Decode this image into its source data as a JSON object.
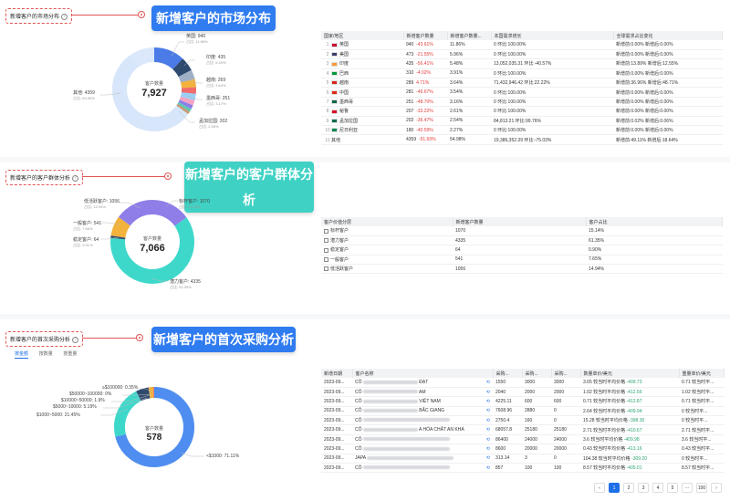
{
  "s1": {
    "tag": "新增客户的市场分布",
    "banner": "新增客户的市场分布",
    "center_label": "客户数量",
    "center_value": "7,927",
    "labels": [
      {
        "name": "英国: 940",
        "pct": "占比: 11.86%"
      },
      {
        "name": "印度: 435",
        "pct": "占比: 5.49%"
      },
      {
        "name": "越南: 269",
        "pct": "占比: 3.64%"
      },
      {
        "name": "墨西哥: 251",
        "pct": "占比: 3.17%"
      },
      {
        "name": "孟加拉国: 202",
        "pct": "占比: 2.55%"
      },
      {
        "name": "其他: 4359",
        "pct": "占比: 54.99%"
      }
    ],
    "headers": [
      "国家/地区",
      "新增客户数量",
      "新增客户数量...",
      "本国需求增长",
      "全球需求占比变化"
    ],
    "rows": [
      {
        "rank": "1",
        "country": "英国",
        "count": "940",
        "chg": "-43.61%",
        "pct": "11.86%",
        "growth": "0  环比:100.00%",
        "share": "新增前:0.00%   新增后:0.00%"
      },
      {
        "rank": "2",
        "country": "美国",
        "count": "473",
        "chg": "-21.55%",
        "pct": "5.96%",
        "growth": "0  环比:100.00%",
        "share": "新增前:0.00%   新增后:0.00%"
      },
      {
        "rank": "3",
        "country": "印度",
        "count": "435",
        "chg": "-56.41%",
        "pct": "5.48%",
        "growth": "13,052,035.31  环比:-40.57%",
        "share": "新增前:13.89%   新增后:12.55%"
      },
      {
        "rank": "4",
        "country": "巴西",
        "count": "310",
        "chg": "-4.02%",
        "pct": "3.91%",
        "growth": "0  环比:100.00%",
        "share": "新增前:0.00%   新增后:0.00%"
      },
      {
        "rank": "5",
        "country": "越南",
        "count": "289",
        "chg": "4.71%",
        "pct": "3.64%",
        "growth": "71,432,946.42  环比:22.22%",
        "share": "新增前:36.96%   新增后:48.71%"
      },
      {
        "rank": "6",
        "country": "中国",
        "count": "281",
        "chg": "-46.67%",
        "pct": "3.54%",
        "growth": "0  环比:100.00%",
        "share": "新增前:0.00%   新增后:0.00%"
      },
      {
        "rank": "7",
        "country": "墨西哥",
        "count": "251",
        "chg": "-48.70%",
        "pct": "3.16%",
        "growth": "0  环比:100.00%",
        "share": "新增前:0.00%   新增后:0.00%"
      },
      {
        "rank": "8",
        "country": "秘鲁",
        "count": "207",
        "chg": "-33.22%",
        "pct": "2.61%",
        "growth": "0  环比:100.00%",
        "share": "新增前:0.00%   新增后:0.00%"
      },
      {
        "rank": "9",
        "country": "孟加拉国",
        "count": "202",
        "chg": "-36.47%",
        "pct": "2.54%",
        "growth": "84,813.21  环比:99.76%",
        "share": "新增前:0.02%   新增后:0.06%"
      },
      {
        "rank": "10",
        "country": "尼日利亚",
        "count": "180",
        "chg": "-40.59%",
        "pct": "2.27%",
        "growth": "0  环比:100.00%",
        "share": "新增前:0.00%   新增后:0.00%"
      },
      {
        "rank": "11",
        "country": "其他",
        "count": "4359",
        "chg": "-51.69%",
        "pct": "54.98%",
        "growth": "19,386,352.39  环比:-75.03%",
        "share": "新增前:49.11%   新增后:18.64%"
      }
    ]
  },
  "s2": {
    "tag": "新增客户的客户群体分析",
    "banner": "新增客户的客户群体分析",
    "center_label": "客户数量",
    "center_value": "7,066",
    "labels": [
      {
        "name": "低活跃客户: 1056",
        "pct": "占比: 14.94%"
      },
      {
        "name": "一般客户: 541",
        "pct": "占比: 7.66%"
      },
      {
        "name": "稳定客户: 64",
        "pct": "占比: 0.91%"
      },
      {
        "name": "标杆客户: 1070",
        "pct": "占比: 15.14%"
      },
      {
        "name": "潜力客户: 4335",
        "pct": "占比: 61.35%"
      }
    ],
    "headers": [
      "客户价值分层",
      "新增客户数量",
      "客户占比"
    ],
    "rows": [
      {
        "name": "标杆客户",
        "count": "1070",
        "pct": "15.14%"
      },
      {
        "name": "潜力客户",
        "count": "4335",
        "pct": "61.35%"
      },
      {
        "name": "稳定客户",
        "count": "64",
        "pct": "0.90%"
      },
      {
        "name": "一般客户",
        "count": "541",
        "pct": "7.65%"
      },
      {
        "name": "低活跃客户",
        "count": "1056",
        "pct": "14.94%"
      }
    ]
  },
  "s3": {
    "tag": "新增客户的首次采购分析",
    "banner": "新增客户的首次采购分析",
    "tabs": [
      "按金额",
      "按数量",
      "按重量"
    ],
    "center_label": "客户数量",
    "center_value": "578",
    "labels": [
      "≥$100000: 0.35%",
      "$50000~100000: 0%",
      "$10000~50000: 1.9%",
      "$5000~10000: 5.19%",
      "$1000~5000: 21.45%",
      "<$1000: 71.11%"
    ],
    "headers": [
      "新增日期",
      "客户名称",
      "采购...",
      "采购...",
      "采购...",
      "数量单价/美元",
      "重量单价/美元"
    ],
    "rows": [
      {
        "date": "2023-09...",
        "name": "CÔ",
        "tail": "ĐẠT",
        "a": "1550",
        "b": "3000",
        "c": "3000",
        "unit": "3.65 较当时平均价格",
        "chg": "-409.73",
        "w": "0.71 较当时平..."
      },
      {
        "date": "2023-09...",
        "name": "CÔ",
        "tail": "AM",
        "a": "2040",
        "b": "2000",
        "c": "2000",
        "unit": "1.02 较当时平均价格",
        "chg": "-412.56",
        "w": "1.02 较当时平..."
      },
      {
        "date": "2023-09...",
        "name": "CÔ",
        "tail": "VIỆT NAM",
        "a": "4225.11",
        "b": "600",
        "c": "600",
        "unit": "0.71 较当时平均价格",
        "chg": "-412.87",
        "w": "0.71 较当时平..."
      },
      {
        "date": "2023-09...",
        "name": "CÔ",
        "tail": "BẮC GIANG",
        "a": "7608.96",
        "b": "2880",
        "c": "0",
        "unit": "2.64 较当时平均价格",
        "chg": "-409.94",
        "w": "0 较当时平..."
      },
      {
        "date": "2023-09...",
        "name": "CÔ",
        "tail": "",
        "a": "2750.4",
        "b": "160",
        "c": "0",
        "unit": "15.28 较当时平均价格",
        "chg": "-398.30",
        "w": "0 较当时平..."
      },
      {
        "date": "2023-09...",
        "name": "CÔ",
        "tail": "A HÓA CHẤT AN KHÁ",
        "a": "68057.8",
        "b": "25180",
        "c": "25180",
        "unit": "2.71 较当时平均价格",
        "chg": "-410.67",
        "w": "2.71 较当时平..."
      },
      {
        "date": "2023-09...",
        "name": "CÔ",
        "tail": "",
        "a": "86400",
        "b": "24000",
        "c": "24000",
        "unit": "3.6 较当时平均价格",
        "chg": "-409.98",
        "w": "3.6 较当时平..."
      },
      {
        "date": "2023-09...",
        "name": "CÔ",
        "tail": "",
        "a": "8600",
        "b": "20000",
        "c": "20000",
        "unit": "0.43 较当时平均价格",
        "chg": "-413.16",
        "w": "0.43 较当时平..."
      },
      {
        "date": "2023-09...",
        "name": "JAPA",
        "tail": "",
        "a": "313.14",
        "b": "3",
        "c": "0",
        "unit": "104.38 较当时平均价格",
        "chg": "-309.20",
        "w": "0 较当时平..."
      },
      {
        "date": "2023-09...",
        "name": "CÔ",
        "tail": "",
        "a": "857",
        "b": "100",
        "c": "100",
        "unit": "8.57 较当时平均价格",
        "chg": "-405.01",
        "w": "8.57 较当时平..."
      }
    ],
    "pages": [
      "‹",
      "1",
      "2",
      "3",
      "4",
      "5",
      "···",
      "100",
      "›"
    ]
  }
}
